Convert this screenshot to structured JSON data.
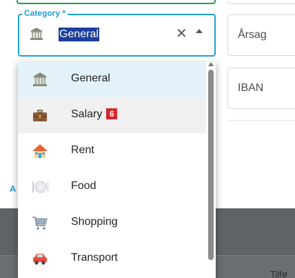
{
  "category_field": {
    "label": "Category *",
    "value": "General",
    "icon": "bank-icon",
    "clear_glyph": "✕"
  },
  "right_fields": {
    "arsag_placeholder": "Årsag",
    "iban_placeholder": "IBAN"
  },
  "left_stub_text": "A",
  "bottom_text": "Tilfø",
  "dropdown": {
    "options": [
      {
        "label": "General",
        "icon": "bank-icon",
        "state": "selected"
      },
      {
        "label": "Salary",
        "icon": "briefcase-icon",
        "state": "hover",
        "badge": "6"
      },
      {
        "label": "Rent",
        "icon": "house-icon"
      },
      {
        "label": "Food",
        "icon": "plate-icon"
      },
      {
        "label": "Shopping",
        "icon": "shopping-cart-icon"
      },
      {
        "label": "Transport",
        "icon": "car-icon"
      }
    ]
  },
  "colors": {
    "accent": "#1aa0d8",
    "selected_bg": "#e3f2f8",
    "hover_bg": "#f0f0f0",
    "badge_bg": "#d9262c",
    "text_selection_bg": "#1a3d9c"
  }
}
